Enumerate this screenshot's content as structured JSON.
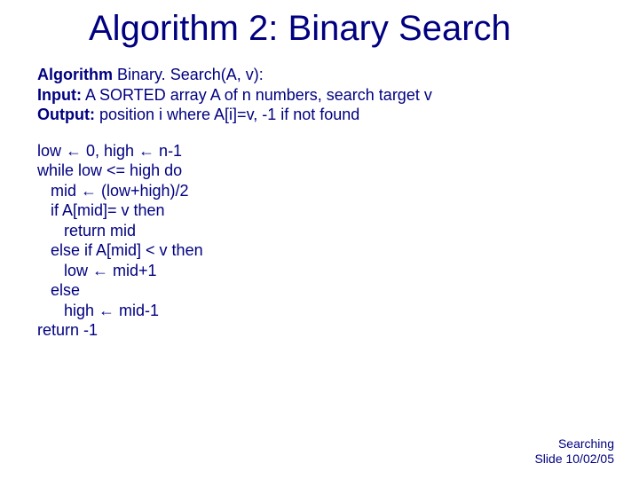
{
  "title": "Algorithm 2:  Binary Search",
  "spec": {
    "algo_label": "Algorithm",
    "algo_text": " Binary. Search(A, v):",
    "input_label": "Input:",
    "input_text": " A SORTED array A of n numbers, search target v",
    "output_label": "Output:",
    "output_text": " position i where A[i]=v, -1 if not found"
  },
  "code": "low ← 0, high ← n-1\nwhile low <= high do\n   mid ← (low+high)/2\n   if A[mid]= v then\n      return mid\n   else if A[mid] < v then\n      low ← mid+1\n   else\n      high ← mid-1\nreturn -1",
  "footer": {
    "line1": "Searching",
    "line2": "Slide 10/02/05"
  }
}
